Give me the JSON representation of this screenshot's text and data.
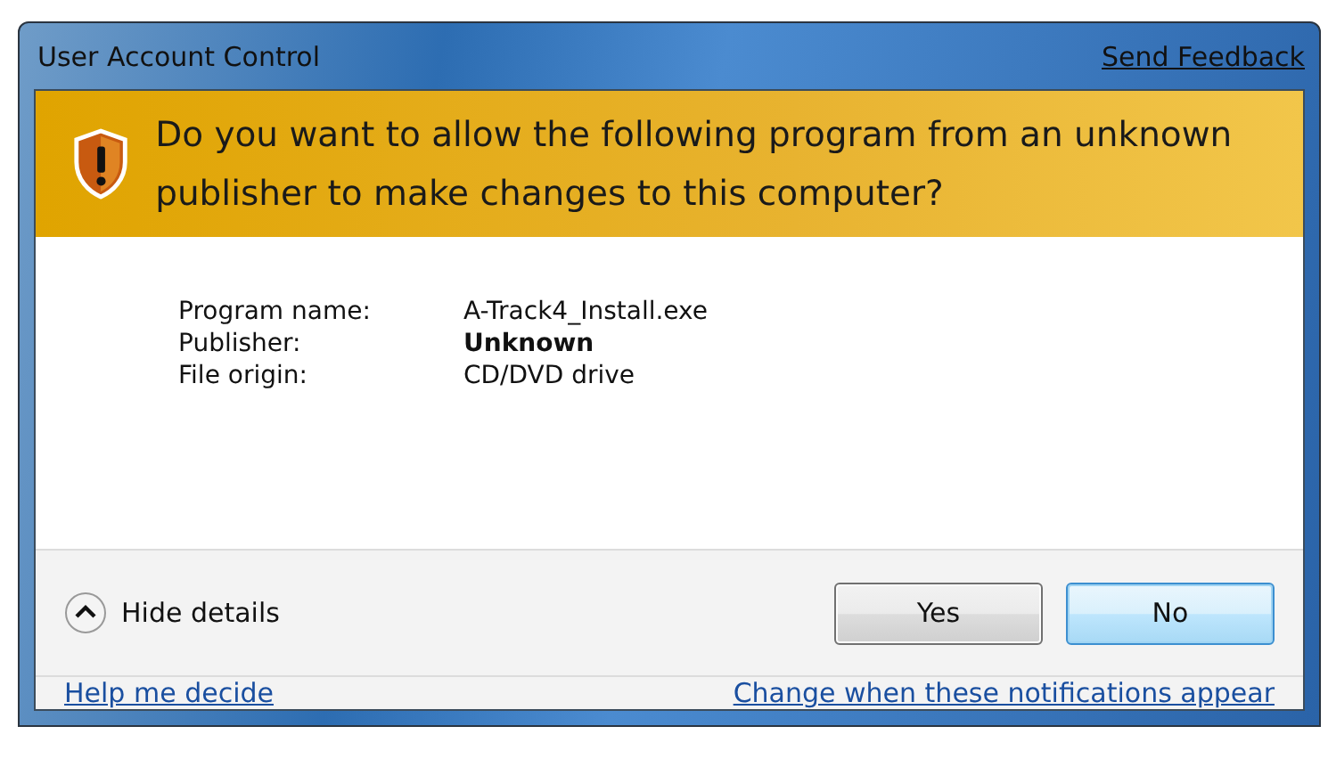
{
  "window": {
    "title": "User Account Control",
    "feedback_link": "Send Feedback"
  },
  "banner": {
    "question": "Do you want to allow the following program from an unknown publisher to make changes to this computer?"
  },
  "details": [
    {
      "label": "Program name:",
      "value": "A-Track4_Install.exe",
      "bold": false
    },
    {
      "label": "Publisher:",
      "value": "Unknown",
      "bold": true
    },
    {
      "label": "File origin:",
      "value": "CD/DVD drive",
      "bold": false
    }
  ],
  "toggle": {
    "label": "Hide details",
    "expanded": true
  },
  "buttons": [
    {
      "label": "Yes",
      "focused": false
    },
    {
      "label": "No",
      "focused": true
    }
  ],
  "links": [
    "Help me decide",
    "Change when these notifications appear"
  ]
}
